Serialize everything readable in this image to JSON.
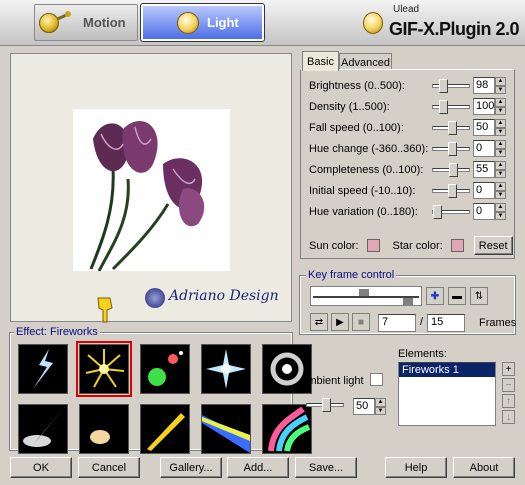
{
  "toolbar": {
    "tabs": [
      {
        "label": "Motion"
      },
      {
        "label": "Light"
      }
    ]
  },
  "brand": {
    "company": "Ulead",
    "product": "GIF-X.Plugin 2.0"
  },
  "preview": {
    "watermark": "Adriano Design"
  },
  "effects": {
    "group_label": "Effect: Fireworks",
    "selected_index": 1
  },
  "params": {
    "tabs": [
      "Basic",
      "Advanced"
    ],
    "rows": [
      {
        "label": "Brightness (0..500):",
        "value": "98",
        "level": 0.196
      },
      {
        "label": "Density (1..500):",
        "value": "100",
        "level": 0.2
      },
      {
        "label": "Fall speed (0..100):",
        "value": "50",
        "level": 0.5
      },
      {
        "label": "Hue change (-360..360):",
        "value": "0",
        "level": 0.5
      },
      {
        "label": "Completeness (0..100):",
        "value": "55",
        "level": 0.55
      },
      {
        "label": "Initial speed (-10..10):",
        "value": "0",
        "level": 0.5
      },
      {
        "label": "Hue variation (0..180):",
        "value": "0",
        "level": 0.0
      }
    ],
    "sun_color_label": "Sun color:",
    "star_color_label": "Star color:",
    "reset_label": "Reset",
    "colors": {
      "sun": "#e2a6b4",
      "star": "#e2a6b4"
    }
  },
  "keyframe": {
    "group_label": "Key frame control",
    "current": "7",
    "total": "15",
    "separator": "/",
    "frames_label": "Frames"
  },
  "ambient": {
    "label": "Ambient light",
    "value": "50",
    "level": 0.5
  },
  "elements": {
    "label": "Elements:",
    "items": [
      "Fireworks 1"
    ]
  },
  "buttons": {
    "ok": "OK",
    "cancel": "Cancel",
    "gallery": "Gallery...",
    "add": "Add...",
    "save": "Save...",
    "help": "Help",
    "about": "About"
  }
}
